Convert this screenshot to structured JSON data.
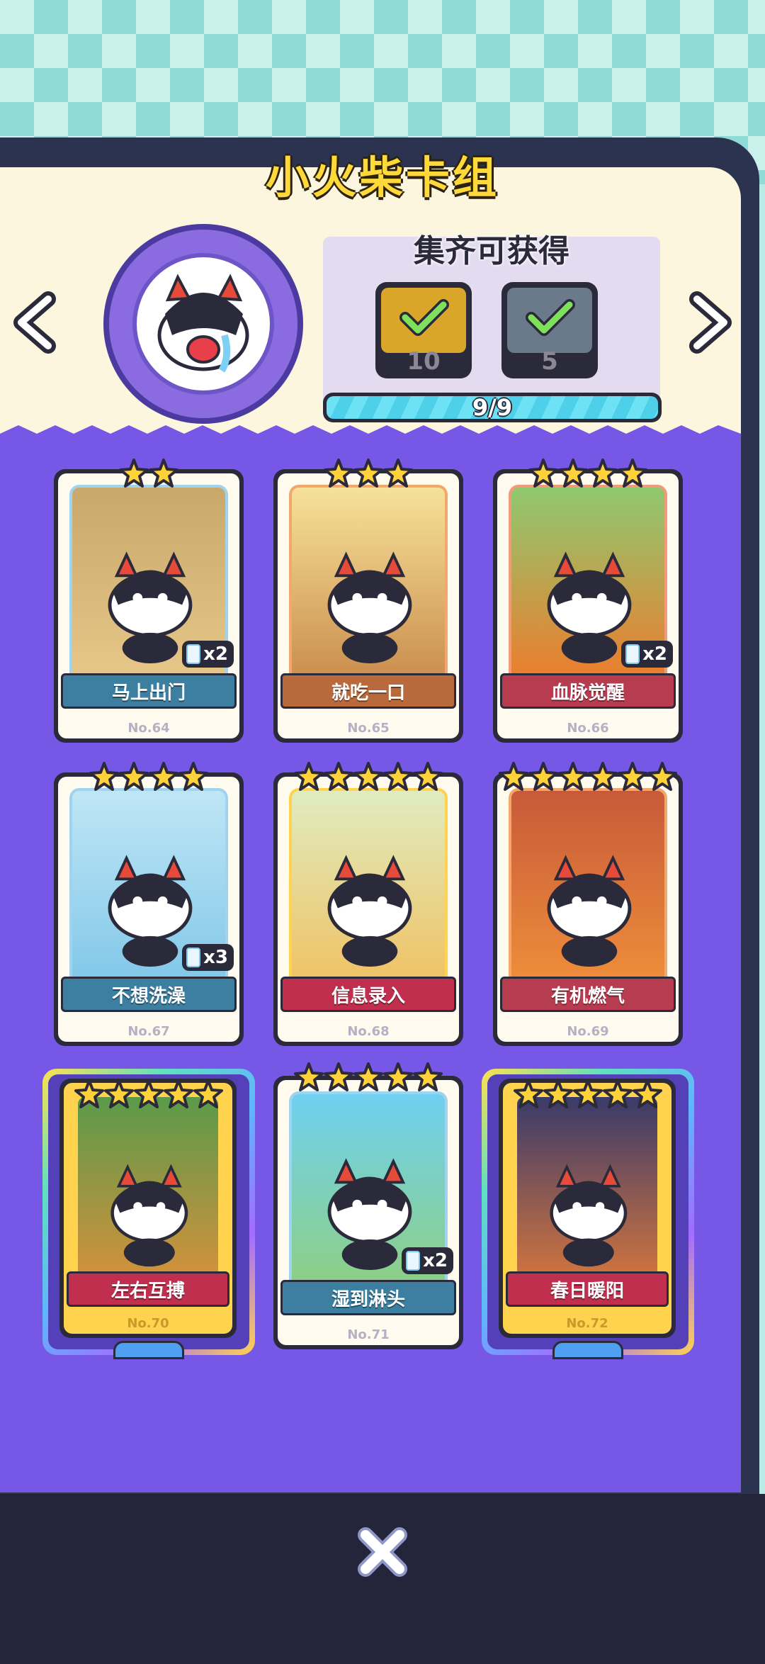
{
  "title": "小火柴卡组",
  "reward": {
    "title": "集齐可获得",
    "items": [
      {
        "icon": "card-pack-icon",
        "count": "10",
        "claimed": true
      },
      {
        "icon": "card-frame-icon",
        "count": "5",
        "claimed": true
      }
    ],
    "progress_text": "9/9",
    "progress": 1.0
  },
  "cards": [
    {
      "name": "马上出门",
      "number": "No.64",
      "stars": 2,
      "duplicates": "x2",
      "ribbon": "#3c7fa0",
      "border": "#9fd3f0",
      "art": [
        "#c9a86b",
        "#e8c98a"
      ]
    },
    {
      "name": "就吃一口",
      "number": "No.65",
      "stars": 3,
      "duplicates": "",
      "ribbon": "#b86a3c",
      "border": "#f2a86a",
      "art": [
        "#f6e29a",
        "#c98a4a"
      ]
    },
    {
      "name": "血脉觉醒",
      "number": "No.66",
      "stars": 4,
      "duplicates": "x2",
      "ribbon": "#b83c50",
      "border": "#f29a7a",
      "art": [
        "#8fc870",
        "#f07a2a"
      ]
    },
    {
      "name": "不想洗澡",
      "number": "No.67",
      "stars": 4,
      "duplicates": "x3",
      "ribbon": "#3c7fa0",
      "border": "#9fd3f0",
      "art": [
        "#bfe6f5",
        "#7fc6e8"
      ]
    },
    {
      "name": "信息录入",
      "number": "No.68",
      "stars": 5,
      "duplicates": "",
      "ribbon": "#c0304e",
      "border": "#ffd34d",
      "art": [
        "#e0ecc0",
        "#f0c060"
      ]
    },
    {
      "name": "有机燃气",
      "number": "No.69",
      "stars": 6,
      "duplicates": "",
      "ribbon": "#b83c50",
      "border": "#f2a86a",
      "art": [
        "#c85a3a",
        "#f0903a"
      ]
    },
    {
      "name": "左右互搏",
      "number": "No.70",
      "stars": 5,
      "duplicates": "",
      "ribbon": "#c0304e",
      "border": "#ffd34d",
      "art": [
        "#5a9a4a",
        "#e0903a"
      ]
    },
    {
      "name": "湿到淋头",
      "number": "No.71",
      "stars": 5,
      "duplicates": "x2",
      "ribbon": "#3c7fa0",
      "border": "#9fd3f0",
      "art": [
        "#6fd0f0",
        "#8fcf80"
      ]
    },
    {
      "name": "春日暖阳",
      "number": "No.72",
      "stars": 5,
      "duplicates": "",
      "ribbon": "#c0304e",
      "border": "#ffd34d",
      "art": [
        "#3a3a6a",
        "#e07a3a"
      ]
    }
  ],
  "colors": {
    "panel_purple": "#7758e6",
    "panel_cream": "#fbf6dd",
    "title_yellow": "#ffd83a",
    "progress_cyan": "#5fd8f0"
  }
}
